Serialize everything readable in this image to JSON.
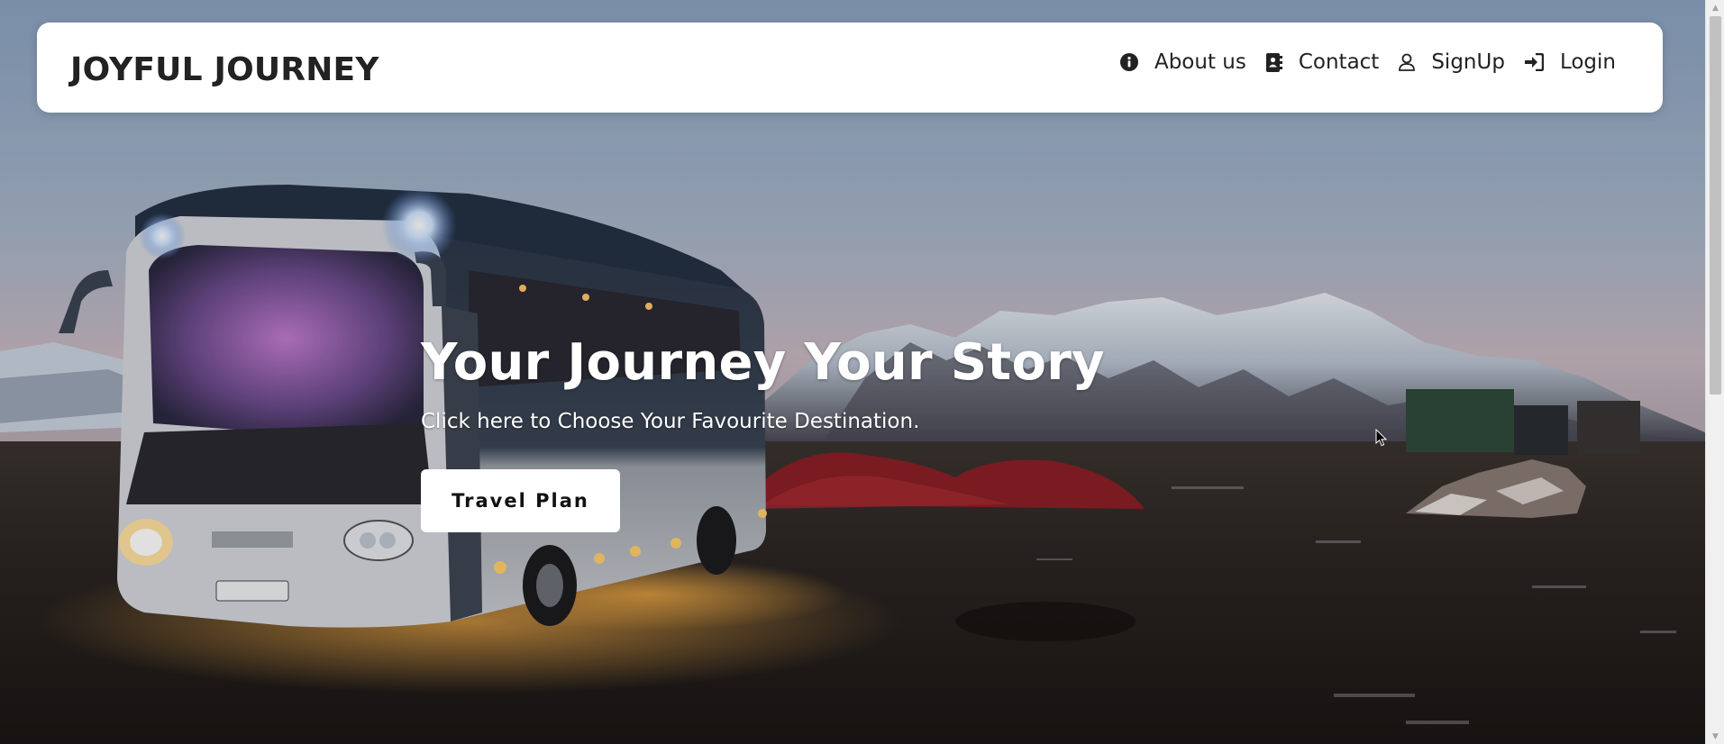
{
  "brand": "JOYFUL JOURNEY",
  "nav": {
    "items": [
      {
        "label": "About us",
        "icon": "info-circle-icon"
      },
      {
        "label": "Contact",
        "icon": "address-book-icon"
      },
      {
        "label": "SignUp",
        "icon": "user-icon"
      },
      {
        "label": "Login",
        "icon": "sign-in-icon"
      }
    ]
  },
  "hero": {
    "title": "Your Journey Your Story",
    "subtitle": "Click here to Choose Your Favourite Destination.",
    "cta_label": "Travel Plan",
    "background": "bus-under-snowy-mountains-at-dusk"
  },
  "colors": {
    "navbar_bg": "#ffffff",
    "brand_text": "#222222",
    "hero_text": "#ffffff",
    "button_bg": "#ffffff"
  }
}
